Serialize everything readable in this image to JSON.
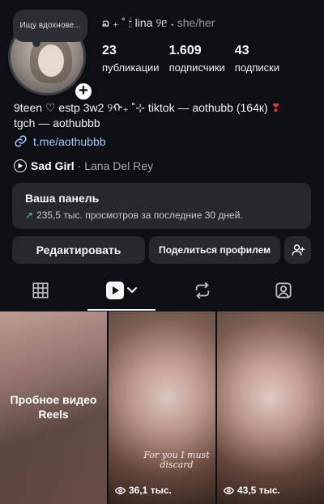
{
  "profile": {
    "note": "Ищу вдохнове...",
    "display_name": "ລ ₊ ˚ 🕯 lina ୨ᥱ ˖",
    "pronouns": "she/her",
    "stats": [
      {
        "value": "23",
        "label": "публикации"
      },
      {
        "value": "1.609",
        "label": "подписчики"
      },
      {
        "value": "43",
        "label": "подписки"
      }
    ],
    "bio_line1": "9teen ♡ estp 3w2 ୨ᡣ₊ ˚⊹ tiktok — aothubb (164к)",
    "bio_heart": "❣",
    "bio_line2": "tgch — aothubbb",
    "link": "t.me/aothubbb",
    "music_song": "Sad Girl",
    "music_artist": "· Lana Del Rey"
  },
  "dashboard": {
    "title": "Ваша панель",
    "arrow": "↗",
    "stats": "235,5 тыс. просмотров за последние 30 дней."
  },
  "buttons": {
    "edit": "Редактировать",
    "share": "Поделиться профилем"
  },
  "tabs": [
    {
      "icon": "grid-icon"
    },
    {
      "icon": "reels-icon"
    },
    {
      "icon": "reposts-icon"
    },
    {
      "icon": "tagged-icon"
    }
  ],
  "posts": [
    {
      "label": "Пробное видео Reels"
    },
    {
      "caption": "For you I must discard",
      "views": "36,1 тыс."
    },
    {
      "views": "43,5 тыс."
    }
  ]
}
